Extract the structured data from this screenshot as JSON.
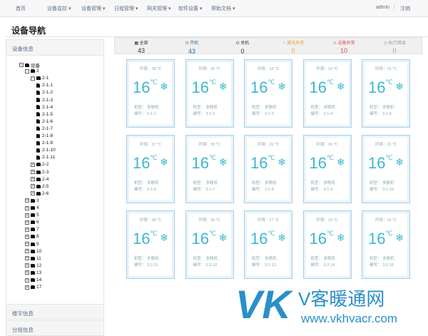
{
  "navbar": {
    "items": [
      "首页",
      "设备监控 ▾",
      "设备管理 ▾",
      "日程管理 ▾",
      "网关管理 ▾",
      "软件设置 ▾",
      "帮助文档 ▾"
    ],
    "user": "admin",
    "logout": "注销"
  },
  "page_title": "设备导航",
  "sidebar": {
    "header": "设备信息",
    "footer_sections": [
      "楼宇信息",
      "分组信息"
    ],
    "tree": [
      {
        "label": "设备",
        "kind": "folder",
        "toggle": "−"
      },
      {
        "label": "2",
        "kind": "folder",
        "toggle": "−"
      },
      {
        "label": "2-1",
        "kind": "folder",
        "toggle": "−"
      },
      {
        "label": "2-1-1",
        "kind": "file"
      },
      {
        "label": "2-1-2",
        "kind": "file"
      },
      {
        "label": "2-1-3",
        "kind": "file"
      },
      {
        "label": "2-1-4",
        "kind": "file"
      },
      {
        "label": "2-1-5",
        "kind": "file"
      },
      {
        "label": "2-1-6",
        "kind": "file"
      },
      {
        "label": "2-1-7",
        "kind": "file"
      },
      {
        "label": "2-1-8",
        "kind": "file"
      },
      {
        "label": "2-1-9",
        "kind": "file"
      },
      {
        "label": "2-1-10",
        "kind": "file"
      },
      {
        "label": "2-1-11",
        "kind": "file"
      },
      {
        "label": "2-2",
        "kind": "folder",
        "toggle": "+"
      },
      {
        "label": "2-3",
        "kind": "folder",
        "toggle": "+"
      },
      {
        "label": "2-4",
        "kind": "folder",
        "toggle": "+"
      },
      {
        "label": "2-5",
        "kind": "folder",
        "toggle": "+"
      },
      {
        "label": "2-6",
        "kind": "folder",
        "toggle": "+"
      },
      {
        "label": "3",
        "kind": "folder",
        "toggle": "+"
      },
      {
        "label": "4",
        "kind": "folder",
        "toggle": "+"
      },
      {
        "label": "5",
        "kind": "folder",
        "toggle": "+"
      },
      {
        "label": "6",
        "kind": "folder",
        "toggle": "+"
      },
      {
        "label": "7",
        "kind": "folder",
        "toggle": "+"
      },
      {
        "label": "8",
        "kind": "folder",
        "toggle": "+"
      },
      {
        "label": "9",
        "kind": "folder",
        "toggle": "+"
      },
      {
        "label": "10",
        "kind": "folder",
        "toggle": "+"
      },
      {
        "label": "11",
        "kind": "folder",
        "toggle": "+"
      },
      {
        "label": "12",
        "kind": "folder",
        "toggle": "+"
      },
      {
        "label": "13",
        "kind": "folder",
        "toggle": "+"
      },
      {
        "label": "14",
        "kind": "folder",
        "toggle": "+"
      },
      {
        "label": "17",
        "kind": "folder",
        "toggle": "+"
      }
    ]
  },
  "stats": [
    {
      "icon": "▦",
      "label": "全部",
      "value": "43",
      "color": "#333333"
    },
    {
      "icon": "⏻",
      "label": "开机",
      "value": "43",
      "color": "#2a6aa8"
    },
    {
      "icon": "⏻",
      "label": "关机",
      "value": "0",
      "color": "#333333"
    },
    {
      "icon": "⚡",
      "label": "通讯异常",
      "value": "0",
      "color": "#e8a33a"
    },
    {
      "icon": "⚠",
      "label": "设备异常",
      "value": "10",
      "color": "#d9534f"
    },
    {
      "icon": "◷",
      "label": "执行错误",
      "value": "0",
      "color": "#999999"
    }
  ],
  "card_labels": {
    "env_prefix": "环境：",
    "model_prefix": "机型：",
    "model": "多联机",
    "no_prefix": "编号：",
    "unit": "℃",
    "mode_icon": "❄"
  },
  "cards": [
    {
      "temp": "16",
      "env": "18 ℃",
      "no": "3-1-1"
    },
    {
      "temp": "16",
      "env": "18 ℃",
      "no": "3-1-2"
    },
    {
      "temp": "16",
      "env": "18 ℃",
      "no": "3-1-3"
    },
    {
      "temp": "16",
      "env": "19 ℃",
      "no": "3-1-4"
    },
    {
      "temp": "16",
      "env": "19 ℃",
      "no": "3-1-5"
    },
    {
      "temp": "16",
      "env": "17 ℃",
      "no": "3-1-6"
    },
    {
      "temp": "16",
      "env": "18 ℃",
      "no": "3-1-7"
    },
    {
      "temp": "16",
      "env": "20 ℃",
      "no": "3-1-8"
    },
    {
      "temp": "16",
      "env": "19 ℃",
      "no": "3-1-9"
    },
    {
      "temp": "16",
      "env": "21 ℃",
      "no": "3-1-10"
    },
    {
      "temp": "16",
      "env": "18 ℃",
      "no": "3-2-11"
    },
    {
      "temp": "16",
      "env": "18 ℃",
      "no": "3-2-12"
    },
    {
      "temp": "16",
      "env": "17 ℃",
      "no": "3-2-13"
    },
    {
      "temp": "16",
      "env": "19 ℃",
      "no": "3-2-14"
    },
    {
      "temp": "16",
      "env": "19 ℃",
      "no": "3-2-15"
    }
  ],
  "watermark": {
    "logo": "VK",
    "name": "V客暖通网",
    "url": "www.vkhvacr.com"
  }
}
